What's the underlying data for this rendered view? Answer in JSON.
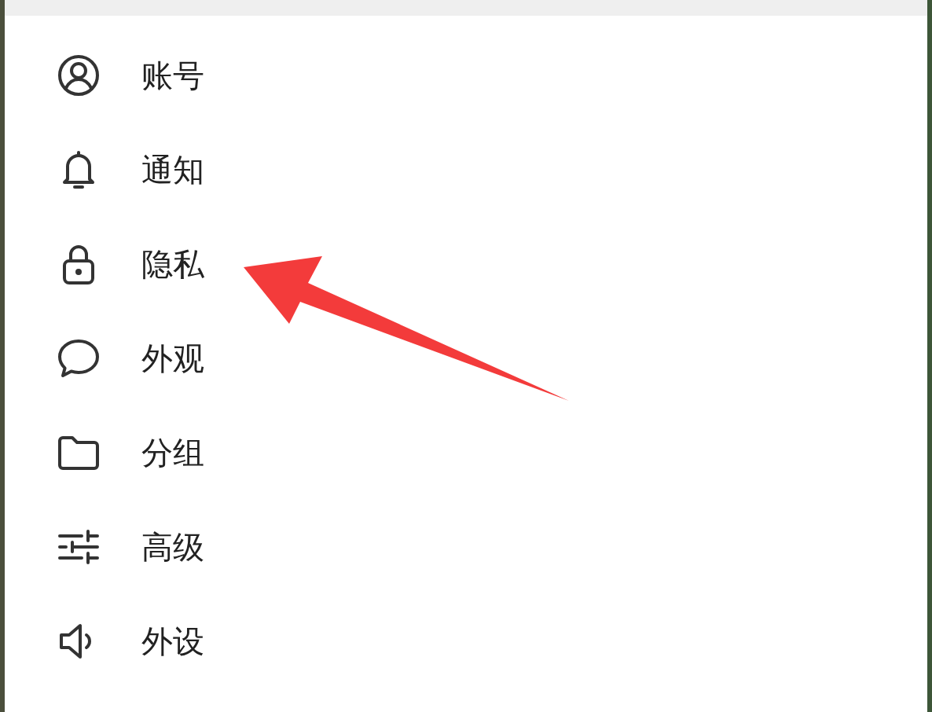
{
  "menu": {
    "items": [
      {
        "label": "账号"
      },
      {
        "label": "通知"
      },
      {
        "label": "隐私"
      },
      {
        "label": "外观"
      },
      {
        "label": "分组"
      },
      {
        "label": "高级"
      },
      {
        "label": "外设"
      }
    ]
  }
}
